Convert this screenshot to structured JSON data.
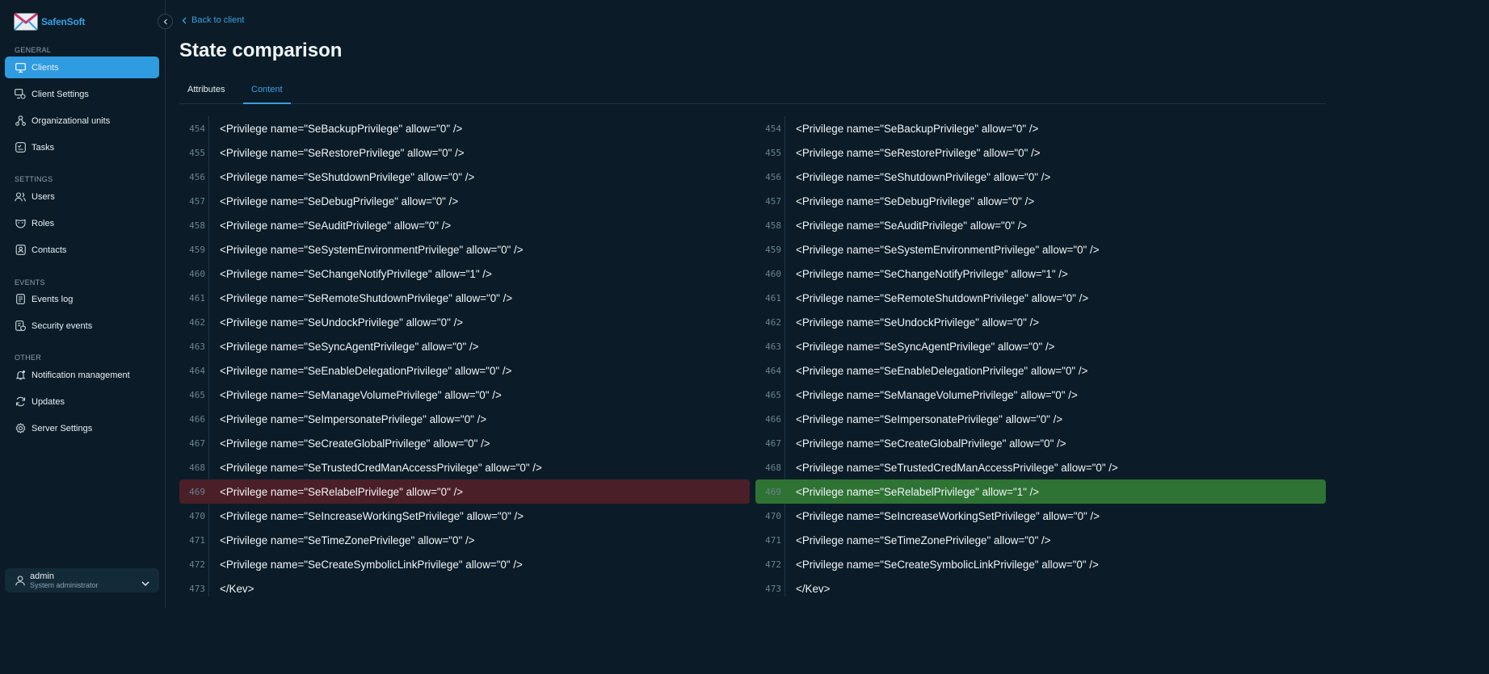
{
  "brand": {
    "name": "SafenSoft"
  },
  "sidebar": {
    "sections": {
      "general": "GENERAL",
      "settings": "SETTINGS",
      "events": "EVENTS",
      "other": "OTHER"
    },
    "items": {
      "clients": "Clients",
      "client_settings": "Client Settings",
      "org_units": "Organizational units",
      "tasks": "Tasks",
      "users": "Users",
      "roles": "Roles",
      "contacts": "Contacts",
      "events_log": "Events log",
      "security_events": "Security events",
      "notification_management": "Notification management",
      "updates": "Updates",
      "server_settings": "Server Settings"
    },
    "user": {
      "name": "admin",
      "role": "System administrator"
    }
  },
  "header": {
    "back_label": "Back to client",
    "title": "State comparison"
  },
  "tabs": {
    "attributes": "Attributes",
    "content": "Content",
    "active": "Content"
  },
  "colors": {
    "accent": "#2f9be0",
    "removed_bg": "#4a1f27",
    "added_bg": "#2f7334",
    "background": "#0b1c28"
  },
  "diff": {
    "left": [
      {
        "ln": "454",
        "code": "<Privilege name=\"SeBackupPrivilege\" allow=\"0\" />",
        "state": ""
      },
      {
        "ln": "455",
        "code": "<Privilege name=\"SeRestorePrivilege\" allow=\"0\" />",
        "state": ""
      },
      {
        "ln": "456",
        "code": "<Privilege name=\"SeShutdownPrivilege\" allow=\"0\" />",
        "state": ""
      },
      {
        "ln": "457",
        "code": "<Privilege name=\"SeDebugPrivilege\" allow=\"0\" />",
        "state": ""
      },
      {
        "ln": "458",
        "code": "<Privilege name=\"SeAuditPrivilege\" allow=\"0\" />",
        "state": ""
      },
      {
        "ln": "459",
        "code": "<Privilege name=\"SeSystemEnvironmentPrivilege\" allow=\"0\" />",
        "state": ""
      },
      {
        "ln": "460",
        "code": "<Privilege name=\"SeChangeNotifyPrivilege\" allow=\"1\" />",
        "state": ""
      },
      {
        "ln": "461",
        "code": "<Privilege name=\"SeRemoteShutdownPrivilege\" allow=\"0\" />",
        "state": ""
      },
      {
        "ln": "462",
        "code": "<Privilege name=\"SeUndockPrivilege\" allow=\"0\" />",
        "state": ""
      },
      {
        "ln": "463",
        "code": "<Privilege name=\"SeSyncAgentPrivilege\" allow=\"0\" />",
        "state": ""
      },
      {
        "ln": "464",
        "code": "<Privilege name=\"SeEnableDelegationPrivilege\" allow=\"0\" />",
        "state": ""
      },
      {
        "ln": "465",
        "code": "<Privilege name=\"SeManageVolumePrivilege\" allow=\"0\" />",
        "state": ""
      },
      {
        "ln": "466",
        "code": "<Privilege name=\"SeImpersonatePrivilege\" allow=\"0\" />",
        "state": ""
      },
      {
        "ln": "467",
        "code": "<Privilege name=\"SeCreateGlobalPrivilege\" allow=\"0\" />",
        "state": ""
      },
      {
        "ln": "468",
        "code": "<Privilege name=\"SeTrustedCredManAccessPrivilege\" allow=\"0\" />",
        "state": ""
      },
      {
        "ln": "469",
        "code": "<Privilege name=\"SeRelabelPrivilege\" allow=\"0\" />",
        "state": "removed"
      },
      {
        "ln": "470",
        "code": "<Privilege name=\"SeIncreaseWorkingSetPrivilege\" allow=\"0\" />",
        "state": ""
      },
      {
        "ln": "471",
        "code": "<Privilege name=\"SeTimeZonePrivilege\" allow=\"0\" />",
        "state": ""
      },
      {
        "ln": "472",
        "code": "<Privilege name=\"SeCreateSymbolicLinkPrivilege\" allow=\"0\" />",
        "state": ""
      },
      {
        "ln": "473",
        "code": "</Kev>",
        "state": ""
      }
    ],
    "right": [
      {
        "ln": "454",
        "code": "<Privilege name=\"SeBackupPrivilege\" allow=\"0\" />",
        "state": ""
      },
      {
        "ln": "455",
        "code": "<Privilege name=\"SeRestorePrivilege\" allow=\"0\" />",
        "state": ""
      },
      {
        "ln": "456",
        "code": "<Privilege name=\"SeShutdownPrivilege\" allow=\"0\" />",
        "state": ""
      },
      {
        "ln": "457",
        "code": "<Privilege name=\"SeDebugPrivilege\" allow=\"0\" />",
        "state": ""
      },
      {
        "ln": "458",
        "code": "<Privilege name=\"SeAuditPrivilege\" allow=\"0\" />",
        "state": ""
      },
      {
        "ln": "459",
        "code": "<Privilege name=\"SeSystemEnvironmentPrivilege\" allow=\"0\" />",
        "state": ""
      },
      {
        "ln": "460",
        "code": "<Privilege name=\"SeChangeNotifyPrivilege\" allow=\"1\" />",
        "state": ""
      },
      {
        "ln": "461",
        "code": "<Privilege name=\"SeRemoteShutdownPrivilege\" allow=\"0\" />",
        "state": ""
      },
      {
        "ln": "462",
        "code": "<Privilege name=\"SeUndockPrivilege\" allow=\"0\" />",
        "state": ""
      },
      {
        "ln": "463",
        "code": "<Privilege name=\"SeSyncAgentPrivilege\" allow=\"0\" />",
        "state": ""
      },
      {
        "ln": "464",
        "code": "<Privilege name=\"SeEnableDelegationPrivilege\" allow=\"0\" />",
        "state": ""
      },
      {
        "ln": "465",
        "code": "<Privilege name=\"SeManageVolumePrivilege\" allow=\"0\" />",
        "state": ""
      },
      {
        "ln": "466",
        "code": "<Privilege name=\"SeImpersonatePrivilege\" allow=\"0\" />",
        "state": ""
      },
      {
        "ln": "467",
        "code": "<Privilege name=\"SeCreateGlobalPrivilege\" allow=\"0\" />",
        "state": ""
      },
      {
        "ln": "468",
        "code": "<Privilege name=\"SeTrustedCredManAccessPrivilege\" allow=\"0\" />",
        "state": ""
      },
      {
        "ln": "469",
        "code": "<Privilege name=\"SeRelabelPrivilege\" allow=\"1\" />",
        "state": "added"
      },
      {
        "ln": "470",
        "code": "<Privilege name=\"SeIncreaseWorkingSetPrivilege\" allow=\"0\" />",
        "state": ""
      },
      {
        "ln": "471",
        "code": "<Privilege name=\"SeTimeZonePrivilege\" allow=\"0\" />",
        "state": ""
      },
      {
        "ln": "472",
        "code": "<Privilege name=\"SeCreateSymbolicLinkPrivilege\" allow=\"0\" />",
        "state": ""
      },
      {
        "ln": "473",
        "code": "</Kev>",
        "state": ""
      }
    ]
  }
}
